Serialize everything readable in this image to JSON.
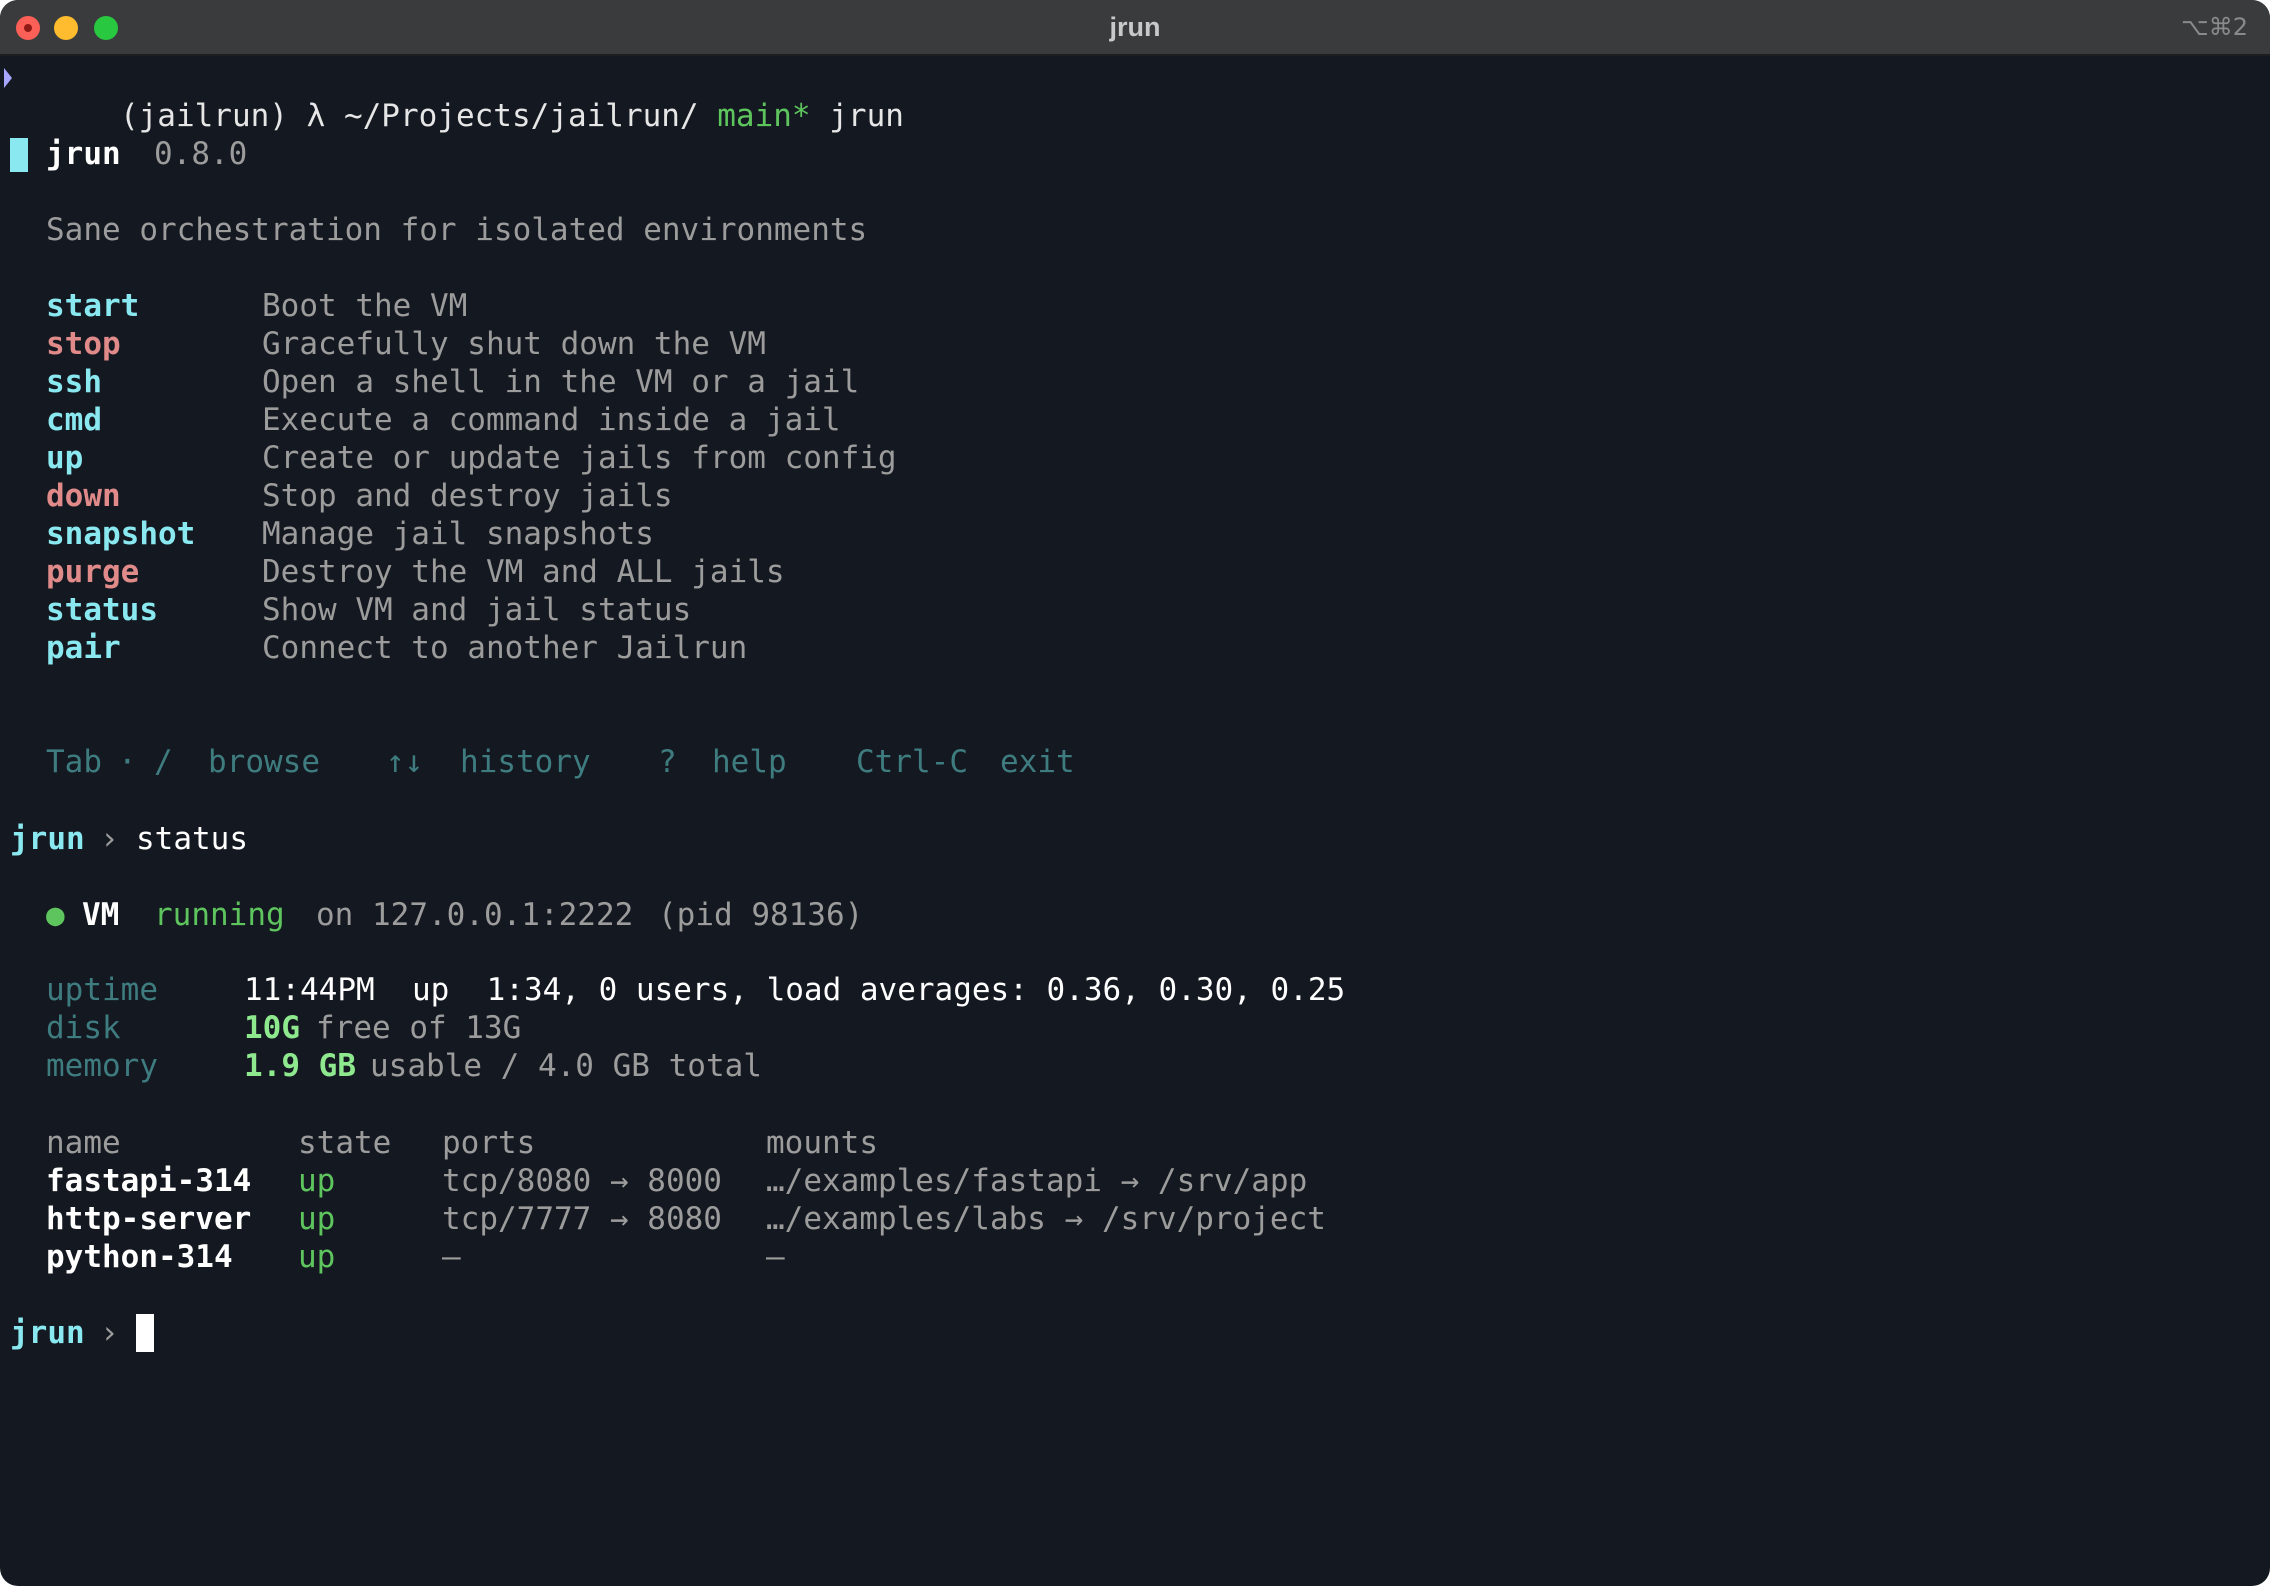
{
  "window": {
    "title": "jrun",
    "shortcut": "⌥⌘2"
  },
  "prompt": {
    "env": "(jailrun)",
    "lambda": "λ",
    "path": "~/Projects/jailrun/",
    "branch": "main*",
    "command": "jrun"
  },
  "app": {
    "name": "jrun",
    "version": "0.8.0",
    "tagline": "Sane orchestration for isolated environments"
  },
  "commands": [
    {
      "name": "start",
      "desc": "Boot the VM",
      "color": "#8ae8f0"
    },
    {
      "name": "stop",
      "desc": "Gracefully shut down the VM",
      "color": "#e08a8a"
    },
    {
      "name": "ssh",
      "desc": "Open a shell in the VM or a jail",
      "color": "#8ae8f0"
    },
    {
      "name": "cmd",
      "desc": "Execute a command inside a jail",
      "color": "#8ae8f0"
    },
    {
      "name": "up",
      "desc": "Create or update jails from config",
      "color": "#8ae8f0"
    },
    {
      "name": "down",
      "desc": "Stop and destroy jails",
      "color": "#e08a8a"
    },
    {
      "name": "snapshot",
      "desc": "Manage jail snapshots",
      "color": "#8ae8f0"
    },
    {
      "name": "purge",
      "desc": "Destroy the VM and ALL jails",
      "color": "#e08a8a"
    },
    {
      "name": "status",
      "desc": "Show VM and jail status",
      "color": "#8ae8f0"
    },
    {
      "name": "pair",
      "desc": "Connect to another Jailrun",
      "color": "#8ae8f0"
    }
  ],
  "hints": {
    "tab_key": "Tab",
    "separator": "·",
    "slash_key": "/",
    "browse": "browse",
    "arrows_key": "↑↓",
    "history": "history",
    "help_key": "?",
    "help": "help",
    "exit_key": "Ctrl-C",
    "exit": "exit"
  },
  "repl": {
    "prompt": "jrun",
    "chevron": "›",
    "command": "status"
  },
  "vm": {
    "dot": "●",
    "label": "VM",
    "state": "running",
    "address": "on 127.0.0.1:2222",
    "pid": "(pid 98136)",
    "uptime_label": "uptime",
    "uptime_value": "11:44PM  up  1:34, 0 users, load averages: 0.36, 0.30, 0.25",
    "disk_label": "disk",
    "disk_free": "10G",
    "disk_rest": "free of 13G",
    "memory_label": "memory",
    "memory_usable": "1.9 GB",
    "memory_rest": "usable / 4.0 GB total"
  },
  "jails_table": {
    "headers": {
      "name": "name",
      "state": "state",
      "ports": "ports",
      "mounts": "mounts"
    },
    "rows": [
      {
        "name": "fastapi-314",
        "state": "up",
        "ports": "tcp/8080 → 8000",
        "mounts": "…/examples/fastapi → /srv/app"
      },
      {
        "name": "http-server",
        "state": "up",
        "ports": "tcp/7777 → 8080",
        "mounts": "…/examples/labs → /srv/project"
      },
      {
        "name": "python-314",
        "state": "up",
        "ports": "—",
        "mounts": "—"
      }
    ]
  },
  "final_prompt": {
    "prompt": "jrun",
    "chevron": "›"
  }
}
